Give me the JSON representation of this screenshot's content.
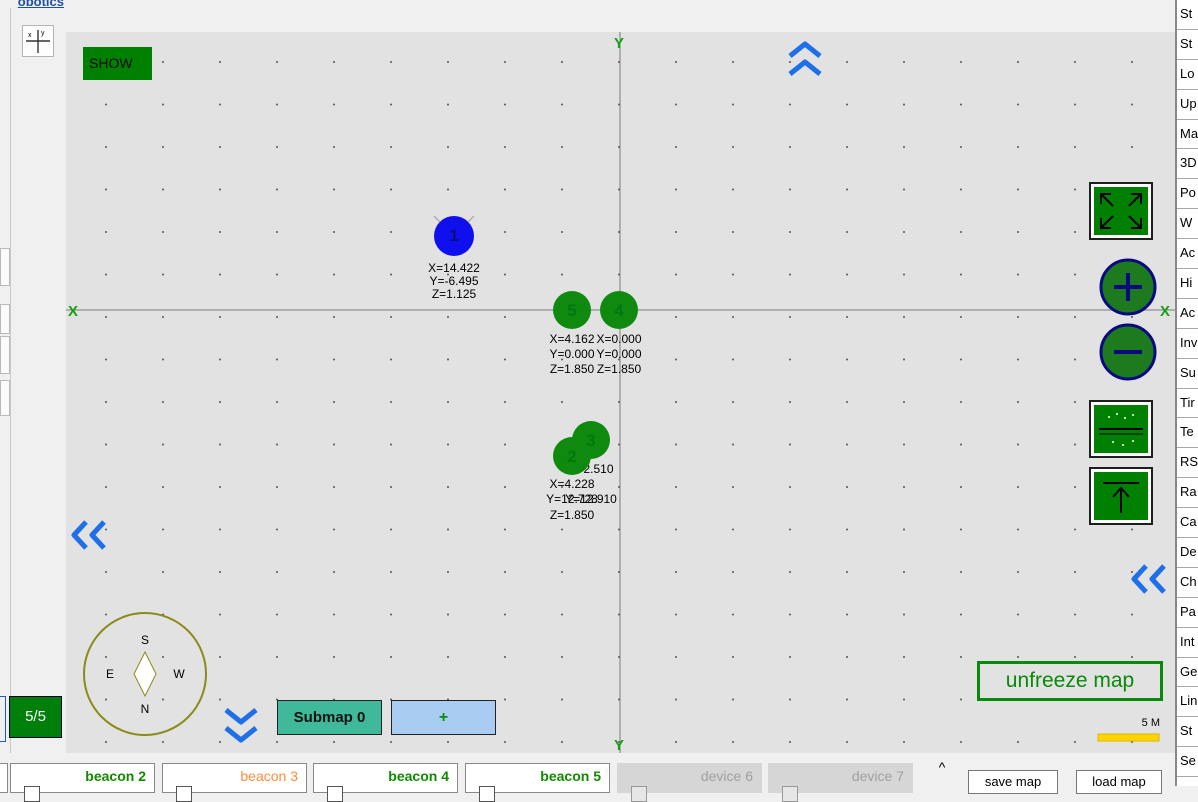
{
  "app": {
    "brand": "obotics"
  },
  "left_panel": {
    "counter": "5/5"
  },
  "map": {
    "show_button": "SHOW",
    "unfreeze_button": "unfreeze map",
    "scale_label": "5 M",
    "compass": {
      "north": "N",
      "south": "S",
      "east": "E",
      "west": "W"
    },
    "axis_labels": {
      "x_left": "X",
      "x_right": "X",
      "y_top": "Y",
      "y_bottom": "Y"
    },
    "submap_button": "Submap 0",
    "add_submap_button": "+",
    "colors": {
      "map_bg": "#e2e2e2",
      "beacon_green": "#0f8a0f",
      "beacon_blue": "#1010ee",
      "accent_blue": "#1f6fe8"
    },
    "beacons": [
      {
        "id": "1",
        "color": "blue",
        "x": "X=14.422",
        "y": "Y=-6.495",
        "z": "Z=1.125"
      },
      {
        "id": "5",
        "color": "green",
        "x": "X=4.162",
        "y": "Y=0.000",
        "z": "Z=1.850"
      },
      {
        "id": "4",
        "color": "green",
        "x": "X=0.000",
        "y": "Y=0.000",
        "z": "Z=1.850"
      },
      {
        "id": "3",
        "color": "green",
        "x": "X=2.510",
        "y": "Y=12.910",
        "z": ""
      },
      {
        "id": "2",
        "color": "green",
        "x": "X=4.228",
        "y": "Y=12.728",
        "z": "Z=1.850"
      }
    ]
  },
  "right_list": [
    "St",
    "St",
    "Lo",
    "Up",
    "Ma",
    "3D",
    "Po",
    "W",
    "Ac",
    "Hi",
    "Ac",
    "Inv",
    "Su",
    "Tir",
    "Te",
    "RS",
    "Ra",
    "Ca",
    "De",
    "Ch",
    "Pa",
    "Int",
    "Ge",
    "Lin",
    "St",
    "Se"
  ],
  "bottom_bar": {
    "tabs": [
      {
        "label": "beacon 2",
        "color": "#118a00",
        "enabled": true
      },
      {
        "label": "beacon 3",
        "color": "#ff8c3a",
        "enabled": true
      },
      {
        "label": "beacon 4",
        "color": "#118a00",
        "enabled": true
      },
      {
        "label": "beacon 5",
        "color": "#118a00",
        "enabled": true
      },
      {
        "label": "device 6",
        "color": "#a0a0a0",
        "enabled": false
      },
      {
        "label": "device 7",
        "color": "#a0a0a0",
        "enabled": false
      }
    ],
    "save_map": "save map",
    "load_map": "load map",
    "up_arrow": "^"
  }
}
